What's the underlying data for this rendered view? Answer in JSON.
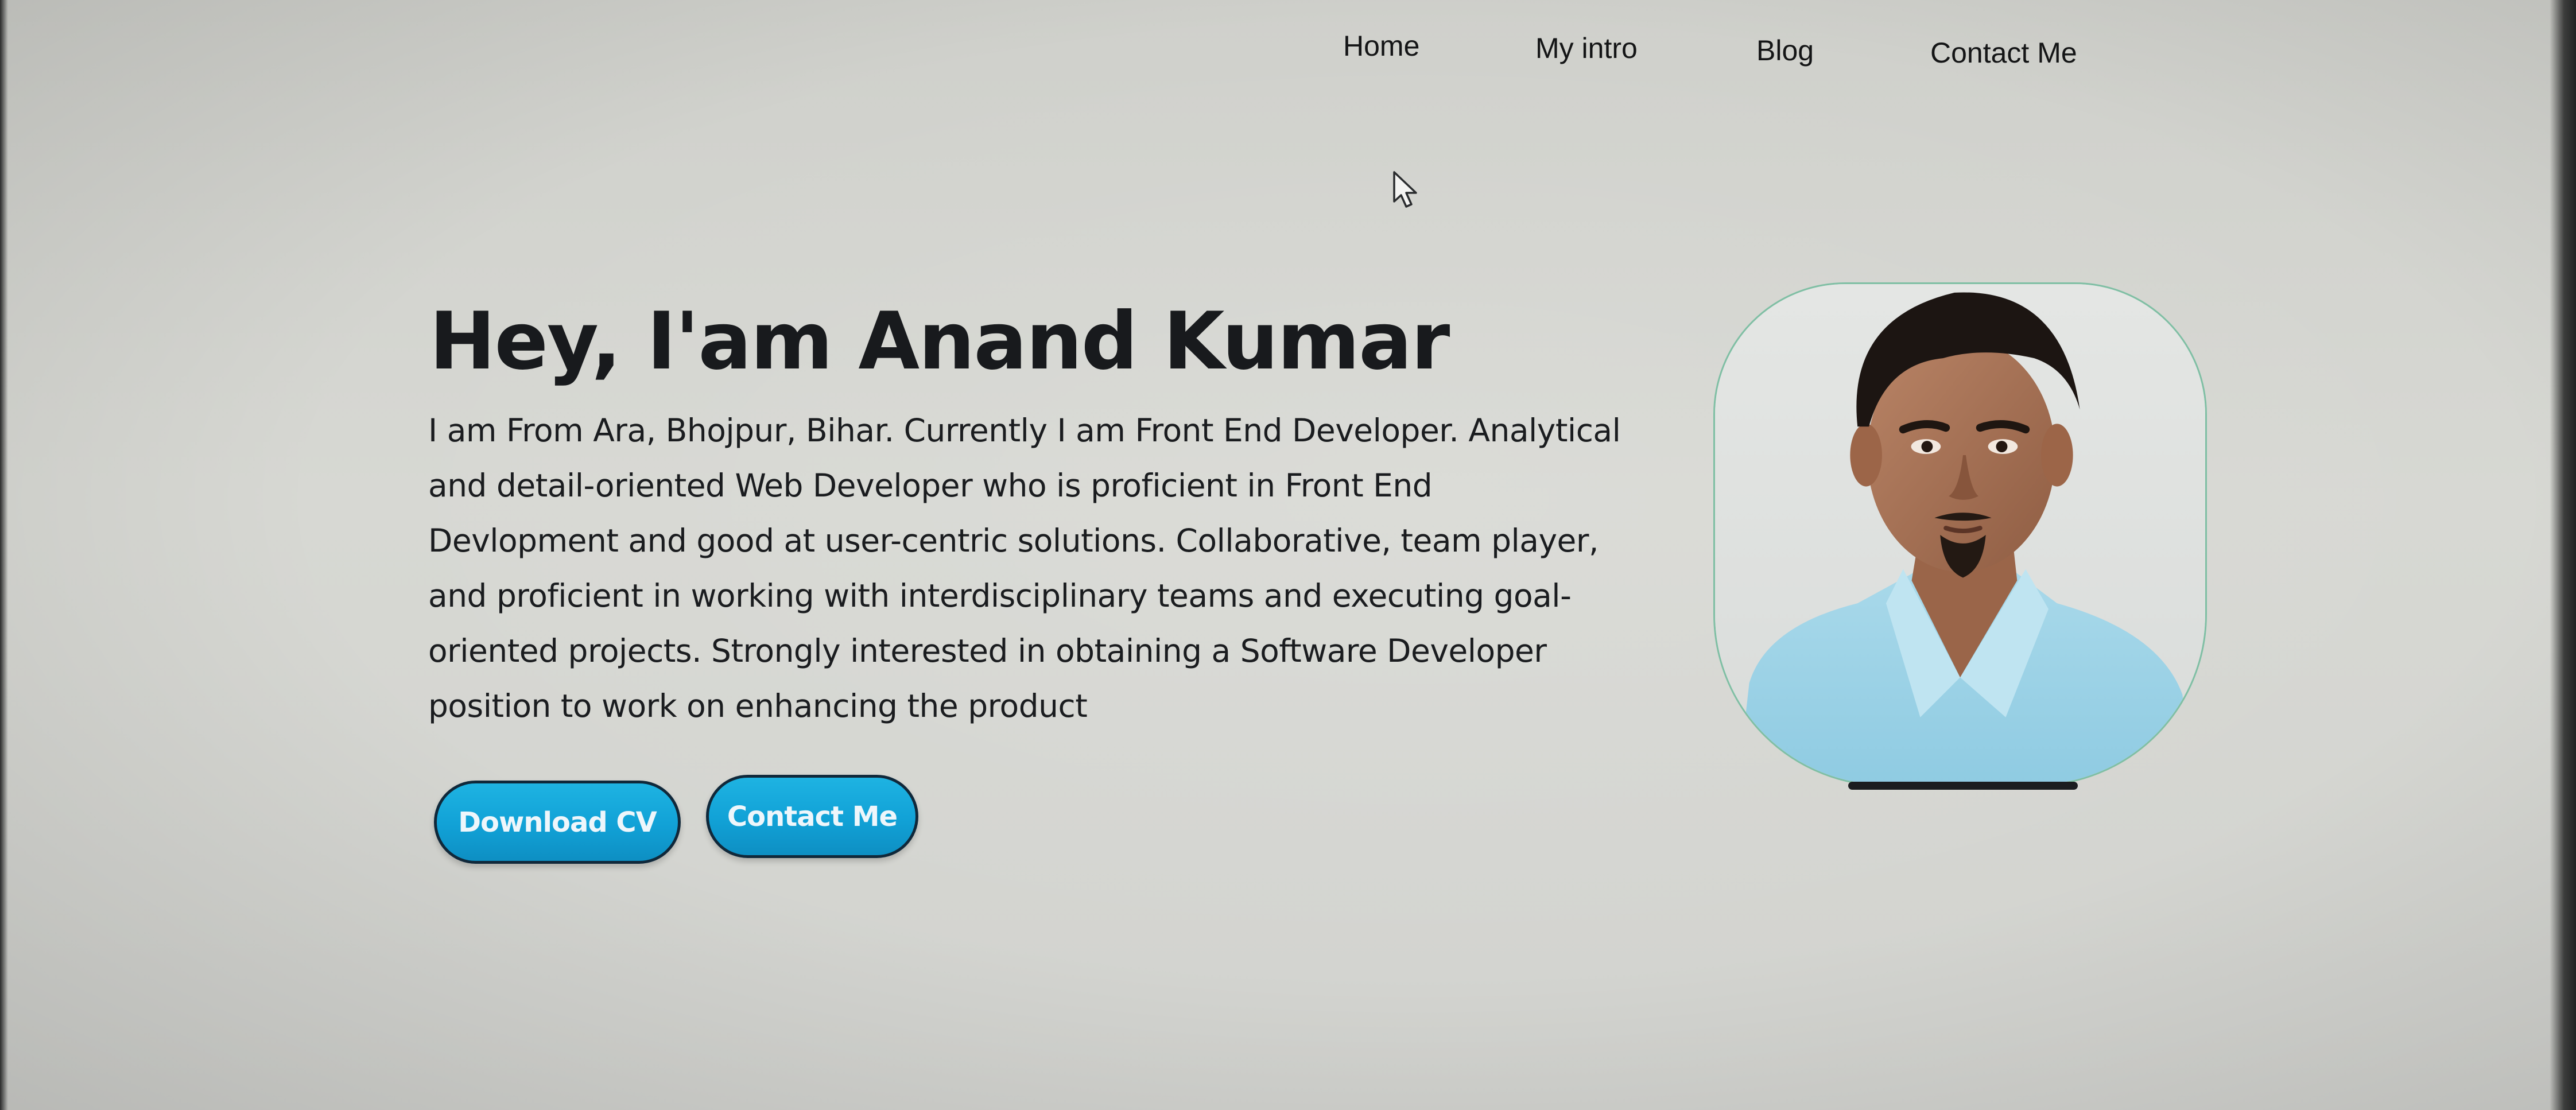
{
  "nav": {
    "items": [
      {
        "label": "Home"
      },
      {
        "label": "My intro"
      },
      {
        "label": "Blog"
      },
      {
        "label": "Contact Me"
      }
    ]
  },
  "hero": {
    "title": "Hey, I'am Anand Kumar",
    "description_lines": [
      "I am From Ara, Bhojpur, Bihar. Currently I am Front End Developer. Analytical",
      "and detail-oriented Web Developer who is proficient in Front End",
      "Devlopment and good at user-centric solutions. Collaborative, team player,",
      "and proficient in working with interdisciplinary teams and executing goal-",
      "oriented projects. Strongly interested in obtaining a Software Developer",
      "position to work on enhancing the product"
    ],
    "buttons": {
      "download_cv": "Download CV",
      "contact_me": "Contact Me"
    }
  },
  "profile": {
    "icon": "profile-photo"
  },
  "colors": {
    "accent": "#13a6da",
    "button_border": "#10283a",
    "background": "#d5d6d1",
    "text": "#1a1c1f",
    "photo_border": "#7fbfa4"
  }
}
